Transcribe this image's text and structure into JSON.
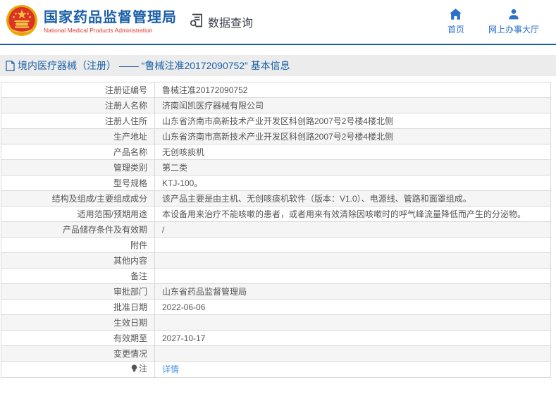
{
  "header": {
    "brand": {
      "title": "国家药品监督管理局",
      "subtitle": "National Medical Products Administration"
    },
    "data_query_label": "数据查询",
    "nav": [
      {
        "label": "首页",
        "icon": "home-icon"
      },
      {
        "label": "网上办事大厅",
        "icon": "person-icon"
      }
    ]
  },
  "breadcrumb": {
    "text": "境内医疗器械（注册） —— “鲁械注准20172090752” 基本信息"
  },
  "table": {
    "rows": [
      {
        "label": "注册证编号",
        "value": "鲁械注准20172090752"
      },
      {
        "label": "注册人名称",
        "value": "济南闰凯医疗器械有限公司"
      },
      {
        "label": "注册人住所",
        "value": "山东省济南市高新技术产业开发区科创路2007号2号楼4楼北侧"
      },
      {
        "label": "生产地址",
        "value": "山东省济南市高新技术产业开发区科创路2007号2号楼4楼北侧"
      },
      {
        "label": "产品名称",
        "value": "无创咳痰机"
      },
      {
        "label": "管理类别",
        "value": "第二类"
      },
      {
        "label": "型号规格",
        "value": "KTJ-100。"
      },
      {
        "label": "结构及组成/主要组成成分",
        "value": "该产品主要是由主机、无创咳痰机软件（版本：V1.0）、电源线、管路和面罩组成。"
      },
      {
        "label": "适用范围/预期用途",
        "value": "本设备用来治疗不能咳嗽的患者，或者用来有效清除因咳嗽时的呼气峰流量降低而产生的分泌物。"
      },
      {
        "label": "产品储存条件及有效期",
        "value": "/"
      },
      {
        "label": "附件",
        "value": ""
      },
      {
        "label": "其他内容",
        "value": ""
      },
      {
        "label": "备注",
        "value": ""
      },
      {
        "label": "审批部门",
        "value": "山东省药品监督管理局"
      },
      {
        "label": "批准日期",
        "value": "2022-06-06"
      },
      {
        "label": "生效日期",
        "value": ""
      },
      {
        "label": "有效期至",
        "value": "2027-10-17"
      },
      {
        "label": "变更情况",
        "value": ""
      },
      {
        "label": "注",
        "value": "详情",
        "value_is_link": true,
        "label_icon": "lightbulb-icon"
      }
    ]
  },
  "colors": {
    "header_border": "#1b5fa9",
    "brand_blue": "#1a5fa8",
    "brand_red": "#d93a30",
    "nav_blue": "#2a6fc9",
    "strip_bg": "#ececec",
    "strip_text": "#1b62a9",
    "row_alt_bg": "#f5f5f6",
    "table_border": "#d9d9d9",
    "link_blue": "#4193de",
    "emblem_red": "#dd3325",
    "emblem_gold": "#f6c445"
  }
}
